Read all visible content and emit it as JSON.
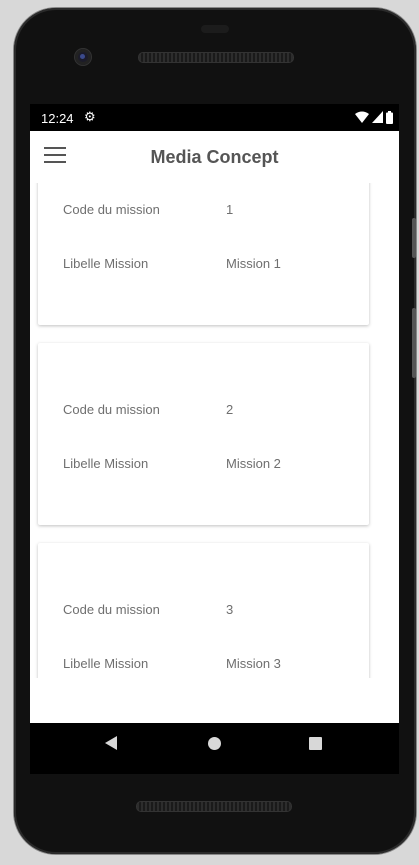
{
  "status_bar": {
    "time": "12:24",
    "icons": [
      "gear-icon",
      "wifi-icon",
      "signal-icon",
      "battery-icon"
    ]
  },
  "app_bar": {
    "title": "Media Concept",
    "menu_icon": "hamburger-menu-icon"
  },
  "missions": [
    {
      "code_label": "Code du mission",
      "code_value": "1",
      "libelle_label": "Libelle Mission",
      "libelle_value": "Mission 1"
    },
    {
      "code_label": "Code du mission",
      "code_value": "2",
      "libelle_label": "Libelle Mission",
      "libelle_value": "Mission 2"
    },
    {
      "code_label": "Code du mission",
      "code_value": "3",
      "libelle_label": "Libelle Mission",
      "libelle_value": "Mission 3"
    }
  ],
  "nav_bar": {
    "buttons": [
      "back-icon",
      "home-icon",
      "recents-icon"
    ]
  },
  "colors": {
    "app_background": "#ffffff",
    "title_text": "#555555",
    "card_text": "#6f6f6f",
    "system_bar": "#000000"
  }
}
